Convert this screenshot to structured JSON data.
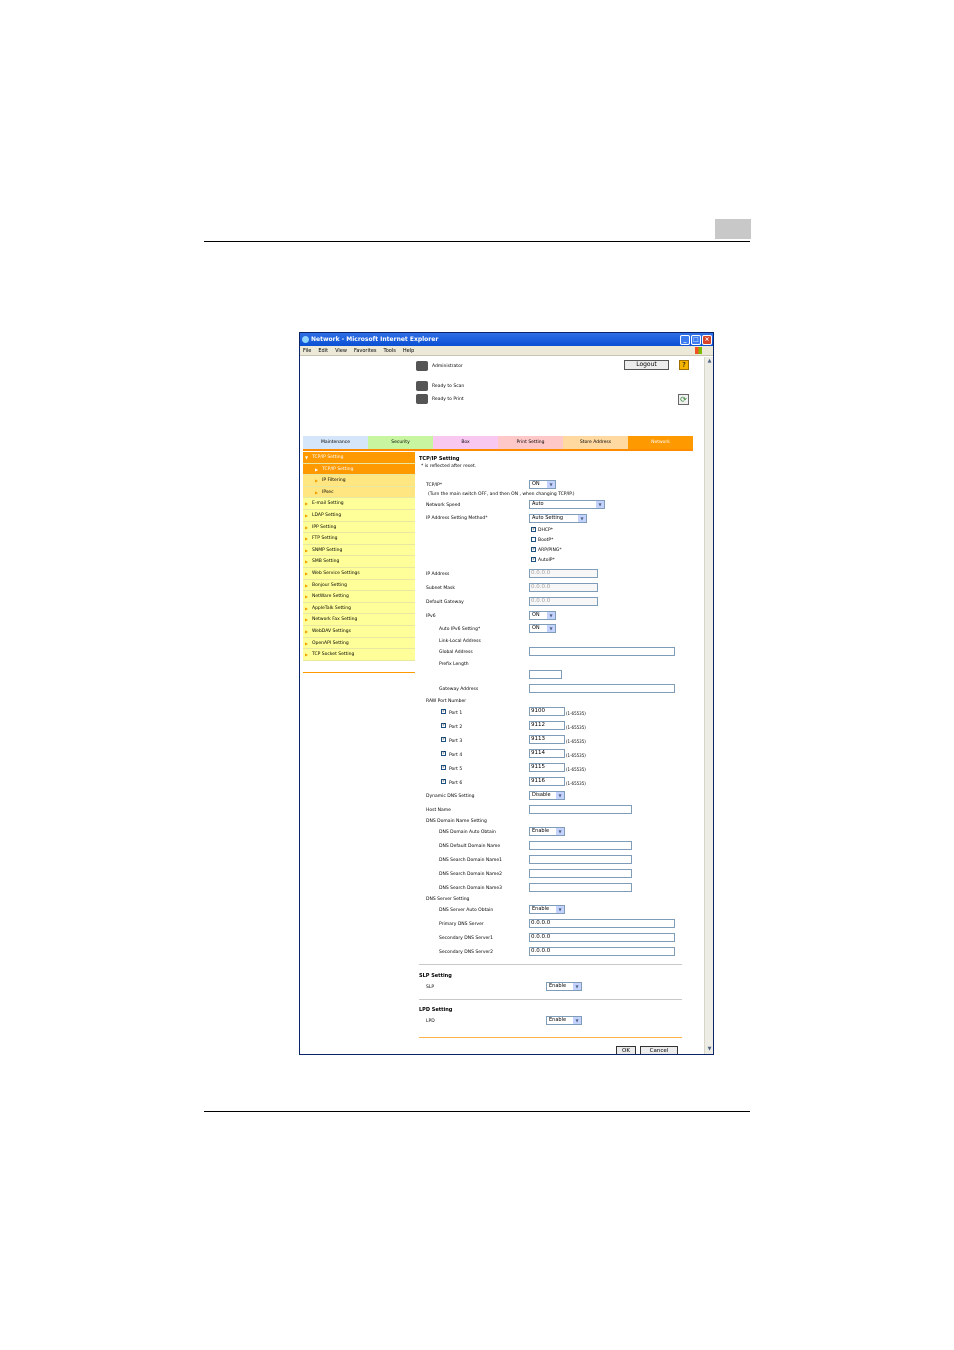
{
  "window": {
    "title": "Network - Microsoft Internet Explorer",
    "menu": [
      "File",
      "Edit",
      "View",
      "Favorites",
      "Tools",
      "Help"
    ]
  },
  "header": {
    "user": "Administrator",
    "logout_label": "Logout",
    "help_label": "?",
    "status_scan": "Ready to Scan",
    "status_print": "Ready to Print"
  },
  "tabs": [
    {
      "label": "Maintenance",
      "color": "#d6e6fa"
    },
    {
      "label": "Security",
      "color": "#c8f5a0"
    },
    {
      "label": "Box",
      "color": "#f8c8f0"
    },
    {
      "label": "Print Setting",
      "color": "#ffc8c8"
    },
    {
      "label": "Store Address",
      "color": "#ffd9a0"
    },
    {
      "label": "Network",
      "color": "#ff9900"
    }
  ],
  "sidebar": {
    "items": [
      {
        "label": "TCP/IP Setting",
        "kind": "open"
      },
      {
        "label": "TCP/IP Setting",
        "kind": "sub-active"
      },
      {
        "label": "IP Filtering",
        "kind": "sub"
      },
      {
        "label": "IPsec",
        "kind": "sub"
      },
      {
        "label": "E-mail Setting",
        "kind": "item"
      },
      {
        "label": "LDAP Setting",
        "kind": "item"
      },
      {
        "label": "IPP Setting",
        "kind": "item"
      },
      {
        "label": "FTP Setting",
        "kind": "item"
      },
      {
        "label": "SNMP Setting",
        "kind": "item"
      },
      {
        "label": "SMB Setting",
        "kind": "item"
      },
      {
        "label": "Web Service Settings",
        "kind": "item"
      },
      {
        "label": "Bonjour Setting",
        "kind": "item"
      },
      {
        "label": "NetWare Setting",
        "kind": "item"
      },
      {
        "label": "AppleTalk Setting",
        "kind": "item"
      },
      {
        "label": "Network Fax Setting",
        "kind": "item"
      },
      {
        "label": "WebDAV Settings",
        "kind": "item"
      },
      {
        "label": "OpenAPI Setting",
        "kind": "item"
      },
      {
        "label": "TCP Socket Setting",
        "kind": "item"
      }
    ]
  },
  "tcpip": {
    "title": "TCP/IP Setting",
    "note": "* is reflected after reset.",
    "tcpip_label": "TCP/IP*",
    "tcpip_value": "ON",
    "tcpip_note": "(Turn the main switch OFF, and then ON , when changing TCP/IP.)",
    "network_speed_label": "Network Speed",
    "network_speed_value": "Auto",
    "ip_method_label": "IP Address Setting Method*",
    "ip_method_value": "Auto Setting",
    "dhcp": "DHCP*",
    "bootp": "BootP*",
    "arp": "ARP/PING*",
    "autoip": "AutoIP*",
    "ip_address_label": "IP Address",
    "ip_address_value": "0.0.0.0",
    "subnet_label": "Subnet Mask",
    "subnet_value": "0.0.0.0",
    "gateway_label": "Default Gateway",
    "gateway_value": "0.0.0.0",
    "ipv6_label": "IPv6",
    "ipv6_value": "ON",
    "auto_ipv6_label": "Auto IPv6 Setting*",
    "auto_ipv6_value": "ON",
    "link_local_label": "Link-Local Address",
    "global_address_label": "Global Address",
    "prefix_label": "Prefix Length",
    "gateway_address_label": "Gateway Address",
    "raw_port_label": "RAW Port Number",
    "ports": [
      {
        "label": "Port 1",
        "value": "9100",
        "range": "(1-65535)"
      },
      {
        "label": "Port 2",
        "value": "9112",
        "range": "(1-65535)"
      },
      {
        "label": "Port 3",
        "value": "9113",
        "range": "(1-65535)"
      },
      {
        "label": "Port 4",
        "value": "9114",
        "range": "(1-65535)"
      },
      {
        "label": "Port 5",
        "value": "9115",
        "range": "(1-65535)"
      },
      {
        "label": "Port 6",
        "value": "9116",
        "range": "(1-65535)"
      }
    ],
    "ddns_label": "Dynamic DNS Setting",
    "ddns_value": "Disable",
    "host_name_label": "Host Name",
    "dns_domain_label": "DNS Domain Name Setting",
    "dns_auto_obtain_label": "DNS Domain Auto Obtain",
    "dns_auto_obtain_value": "Enable",
    "dns_default_domain_label": "DNS Default Domain Name",
    "dns_search1_label": "DNS Search Domain Name1",
    "dns_search2_label": "DNS Search Domain Name2",
    "dns_search3_label": "DNS Search Domain Name3",
    "dns_server_label": "DNS Server Setting",
    "dns_server_auto_label": "DNS Server Auto Obtain",
    "dns_server_auto_value": "Enable",
    "primary_dns_label": "Primary DNS Server",
    "primary_dns_value": "0.0.0.0",
    "secondary1_label": "Secondary DNS Server1",
    "secondary1_value": "0.0.0.0",
    "secondary2_label": "Secondary DNS Server2",
    "secondary2_value": "0.0.0.0"
  },
  "slp": {
    "title": "SLP Setting",
    "label": "SLP",
    "value": "Enable"
  },
  "lpd": {
    "title": "LPD Setting",
    "label": "LPD",
    "value": "Enable"
  },
  "actions": {
    "ok": "OK",
    "cancel": "Cancel"
  }
}
